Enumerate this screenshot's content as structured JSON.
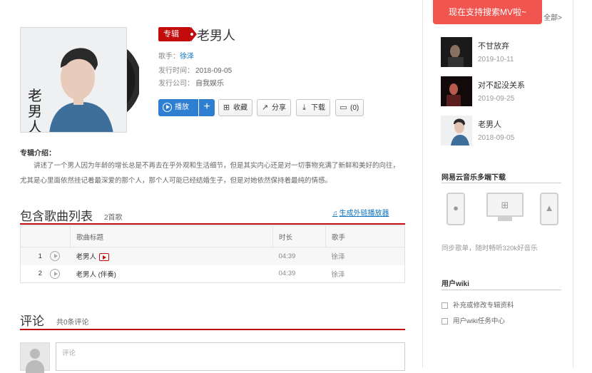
{
  "album": {
    "badge": "专辑",
    "title": "老男人",
    "artist_label": "歌手：",
    "artist": "徐泽",
    "release_label": "发行时间：",
    "release_date": "2018-09-05",
    "company_label": "发行公司：",
    "company": "自我娱乐",
    "cover_text": "老男人"
  },
  "actions": {
    "play": "播放",
    "plus": "+",
    "collect": "收藏",
    "share": "分享",
    "download": "下载",
    "comment": "(0)"
  },
  "intro": {
    "title": "专辑介绍：",
    "text": "讲述了一个男人因为年龄的增长总是不再去在乎外观和生活细节，但是其实内心还是对一切事物充满了新鲜和美好的向往，尤其是心里面依然挂记着最深爱的那个人，那个人可能已经结婚生子，但是对她依然保持着最纯的情感。"
  },
  "songlist": {
    "title": "包含歌曲列表",
    "count": "2首歌",
    "gen_link": "生成外链播放器",
    "headers": [
      "",
      "歌曲标题",
      "时长",
      "歌手"
    ],
    "rows": [
      {
        "index": "1",
        "title": "老男人",
        "duration": "04:39",
        "artist": "徐泽",
        "has_mv": true
      },
      {
        "index": "2",
        "title": "老男人 (伴奏)",
        "duration": "04:39",
        "artist": "徐泽",
        "has_mv": false
      }
    ]
  },
  "comments": {
    "title": "评论",
    "count": "共0条评论",
    "placeholder": "评论"
  },
  "sidebar": {
    "tooltip": "现在支持搜索MV啦~",
    "all_link": "全部>",
    "related": [
      {
        "name": "不甘放弃",
        "date": "2019-10-11"
      },
      {
        "name": "对不起没关系",
        "date": "2019-09-25"
      },
      {
        "name": "老男人",
        "date": "2018-09-05"
      }
    ],
    "download_title": "网易云音乐多端下载",
    "sync_text": "同步歌单，随时畅听320k好音乐",
    "wiki_title": "用户wiki",
    "wiki_items": [
      "补充或修改专辑资料",
      "用户wiki任务中心"
    ]
  },
  "colors": {
    "brand_red": "#c20c0c",
    "play_blue": "#2e7fd2",
    "link_blue": "#0c73c2",
    "tooltip_red": "#f0554f"
  }
}
